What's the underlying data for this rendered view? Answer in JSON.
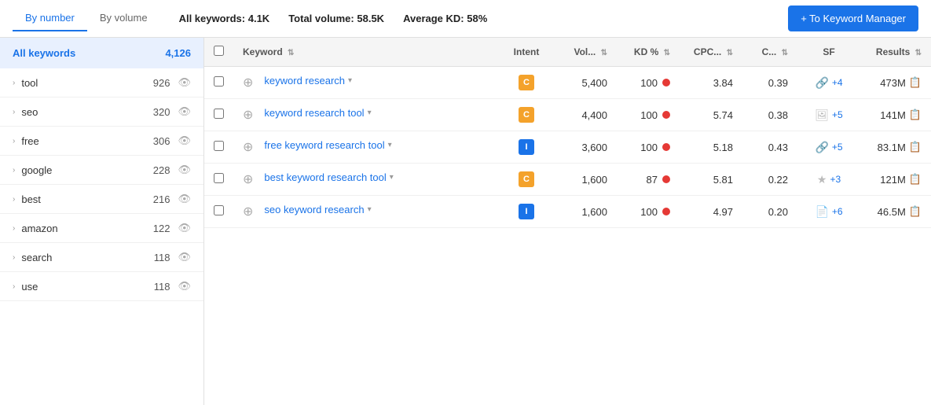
{
  "tabs": [
    {
      "id": "by-number",
      "label": "By number",
      "active": true
    },
    {
      "id": "by-volume",
      "label": "By volume",
      "active": false
    }
  ],
  "stats": {
    "all_keywords_label": "All keywords:",
    "all_keywords_value": "4.1K",
    "total_volume_label": "Total volume:",
    "total_volume_value": "58.5K",
    "avg_kd_label": "Average KD:",
    "avg_kd_value": "58%"
  },
  "btn_keyword_manager": "+ To Keyword Manager",
  "sidebar": {
    "all_keywords_label": "All keywords",
    "all_keywords_count": "4,126",
    "items": [
      {
        "name": "tool",
        "count": "926"
      },
      {
        "name": "seo",
        "count": "320"
      },
      {
        "name": "free",
        "count": "306"
      },
      {
        "name": "google",
        "count": "228"
      },
      {
        "name": "best",
        "count": "216"
      },
      {
        "name": "amazon",
        "count": "122"
      },
      {
        "name": "search",
        "count": "118"
      },
      {
        "name": "use",
        "count": "118"
      }
    ]
  },
  "table": {
    "columns": [
      {
        "id": "checkbox",
        "label": ""
      },
      {
        "id": "keyword",
        "label": "Keyword"
      },
      {
        "id": "intent",
        "label": "Intent"
      },
      {
        "id": "volume",
        "label": "Vol..."
      },
      {
        "id": "kd",
        "label": "KD %"
      },
      {
        "id": "cpc",
        "label": "CPC..."
      },
      {
        "id": "c",
        "label": "C..."
      },
      {
        "id": "sf",
        "label": "SF"
      },
      {
        "id": "results",
        "label": "Results"
      }
    ],
    "rows": [
      {
        "id": 1,
        "keyword": "keyword research",
        "intent": "C",
        "intent_type": "c",
        "volume": "5,400",
        "kd": "100",
        "kd_color": "red",
        "cpc": "3.84",
        "c": "0.39",
        "sf_icon": "link",
        "sf_count": "+4",
        "results": "473M"
      },
      {
        "id": 2,
        "keyword": "keyword research tool",
        "intent": "C",
        "intent_type": "c",
        "volume": "4,400",
        "kd": "100",
        "kd_color": "red",
        "cpc": "5.74",
        "c": "0.38",
        "sf_icon": "image",
        "sf_count": "+5",
        "results": "141M"
      },
      {
        "id": 3,
        "keyword": "free keyword research tool",
        "intent": "I",
        "intent_type": "i",
        "volume": "3,600",
        "kd": "100",
        "kd_color": "red",
        "cpc": "5.18",
        "c": "0.43",
        "sf_icon": "link",
        "sf_count": "+5",
        "results": "83.1M"
      },
      {
        "id": 4,
        "keyword": "best keyword research tool",
        "intent": "C",
        "intent_type": "c",
        "volume": "1,600",
        "kd": "87",
        "kd_color": "red",
        "cpc": "5.81",
        "c": "0.22",
        "sf_icon": "star",
        "sf_count": "+3",
        "results": "121M"
      },
      {
        "id": 5,
        "keyword": "seo keyword research",
        "intent": "I",
        "intent_type": "i",
        "volume": "1,600",
        "kd": "100",
        "kd_color": "red",
        "cpc": "4.97",
        "c": "0.20",
        "sf_icon": "doc",
        "sf_count": "+6",
        "results": "46.5M"
      }
    ]
  }
}
